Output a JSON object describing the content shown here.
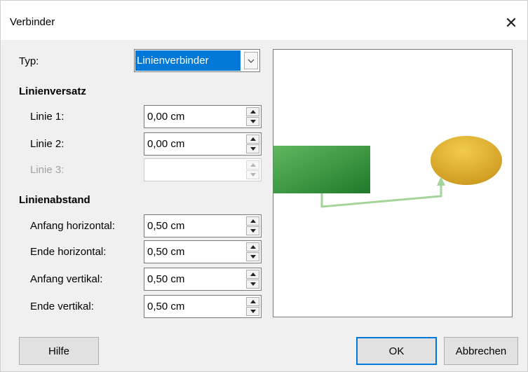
{
  "dialog": {
    "title": "Verbinder",
    "close_glyph": "✕"
  },
  "type": {
    "label": "Typ:",
    "value": "Linienverbinder"
  },
  "line_skew": {
    "heading": "Linienversatz",
    "fields": [
      {
        "label": "Linie 1:",
        "value": "0,00 cm",
        "enabled": true
      },
      {
        "label": "Linie 2:",
        "value": "0,00 cm",
        "enabled": true
      },
      {
        "label": "Linie 3:",
        "value": "",
        "enabled": false
      }
    ]
  },
  "line_spacing": {
    "heading": "Linienabstand",
    "fields": [
      {
        "label": "Anfang horizontal:",
        "value": "0,50 cm"
      },
      {
        "label": "Ende horizontal:",
        "value": "0,50 cm"
      },
      {
        "label": "Anfang vertikal:",
        "value": "0,50 cm"
      },
      {
        "label": "Ende vertikal:",
        "value": "0,50 cm"
      }
    ]
  },
  "buttons": {
    "help": "Hilfe",
    "ok": "OK",
    "cancel": "Abbrechen"
  },
  "colors": {
    "accent": "#0078d7",
    "rect_fill_light": "#5fb85f",
    "rect_fill_dark": "#1f7a2a",
    "ellipse_fill_light": "#f2cc4c",
    "ellipse_fill_dark": "#c9941a",
    "connector": "#a5d49b"
  }
}
